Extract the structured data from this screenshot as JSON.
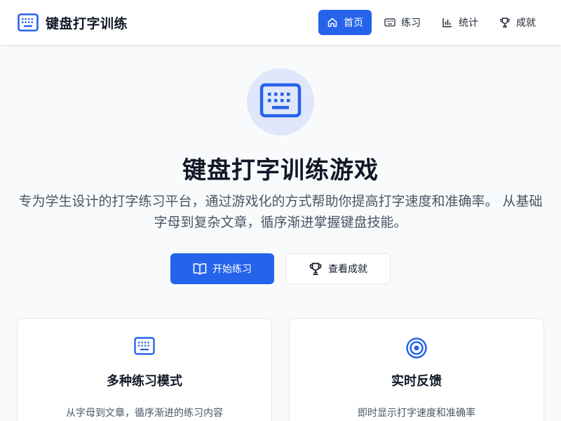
{
  "app": {
    "title": "键盘打字训练",
    "logo_icon": "keyboard-icon"
  },
  "nav": {
    "items": [
      {
        "label": "首页",
        "icon": "home-icon",
        "active": true
      },
      {
        "label": "练习",
        "icon": "keyboard-icon",
        "active": false
      },
      {
        "label": "统计",
        "icon": "bar-chart-icon",
        "active": false
      },
      {
        "label": "成就",
        "icon": "trophy-icon",
        "active": false
      }
    ]
  },
  "hero": {
    "icon": "keyboard-icon",
    "title": "键盘打字训练游戏",
    "description": "专为学生设计的打字练习平台，通过游戏化的方式帮助你提高打字速度和准确率。 从基础字母到复杂文章，循序渐进掌握键盘技能。"
  },
  "actions": {
    "start_label": "开始练习",
    "start_icon": "book-open-icon",
    "achievements_label": "查看成就",
    "achievements_icon": "trophy-icon"
  },
  "features": [
    {
      "icon": "keyboard-icon",
      "title": "多种练习模式",
      "description": "从字母到文章，循序渐进的练习内容"
    },
    {
      "icon": "target-icon",
      "title": "实时反馈",
      "description": "即时显示打字速度和准确率"
    }
  ],
  "colors": {
    "primary": "#2563eb",
    "background": "#f8fafc",
    "hero_icon_bg": "#e0e7fa",
    "text_dark": "#111827",
    "text_muted": "#4b5563"
  }
}
